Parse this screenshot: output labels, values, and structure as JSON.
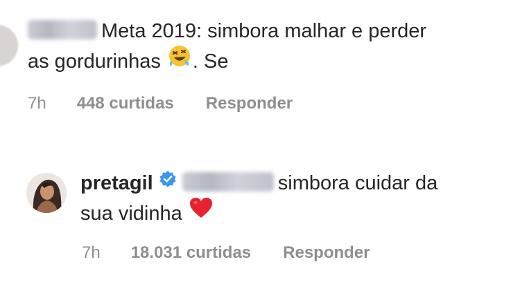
{
  "comments": [
    {
      "username": "",
      "text_line1": "Meta 2019: simbora malhar e perder",
      "text_line2a": "as gordurinhas",
      "text_line2b": ". Se",
      "emoji": "rolling-on-floor-laughing",
      "time": "7h",
      "likes": "448 curtidas",
      "reply_label": "Responder"
    },
    {
      "username": "pretagil",
      "verified": true,
      "mention_blurred": true,
      "text_line1": "simbora cuidar da",
      "text_line2": "sua vidinha",
      "emoji": "red-heart",
      "time": "7h",
      "likes": "18.031 curtidas",
      "reply_label": "Responder"
    }
  ],
  "colors": {
    "text": "#262626",
    "meta": "#8e8e8e",
    "verified": "#3897f0",
    "heart": "#e8222f",
    "emoji_face": "#f7c330"
  }
}
